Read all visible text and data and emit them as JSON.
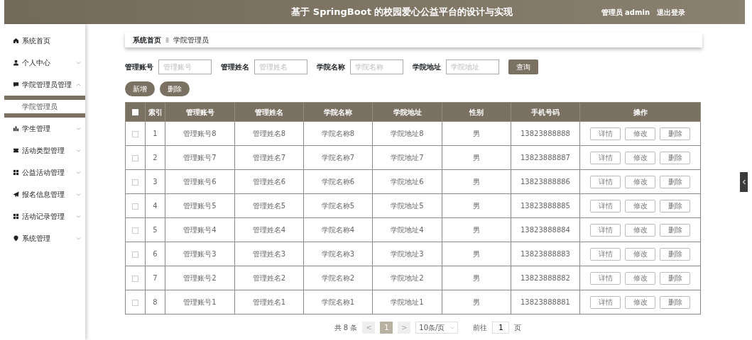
{
  "header": {
    "title": "基于 SpringBoot 的校园爱心公益平台的设计与实现",
    "user": "管理员 admin",
    "logout": "退出登录"
  },
  "sidebar": {
    "items": [
      {
        "label": "系统首页",
        "kind": "link"
      },
      {
        "label": "个人中心",
        "kind": "menu",
        "expanded": false
      },
      {
        "label": "学院管理员管理",
        "kind": "menu",
        "expanded": true,
        "children": [
          {
            "label": "学院管理员",
            "selected": true
          }
        ]
      },
      {
        "label": "学生管理",
        "kind": "menu",
        "expanded": false
      },
      {
        "label": "活动类型管理",
        "kind": "menu",
        "expanded": false
      },
      {
        "label": "公益活动管理",
        "kind": "menu",
        "expanded": false
      },
      {
        "label": "报名信息管理",
        "kind": "menu",
        "expanded": false
      },
      {
        "label": "活动记录管理",
        "kind": "menu",
        "expanded": false
      },
      {
        "label": "系统管理",
        "kind": "menu",
        "expanded": false
      }
    ]
  },
  "breadcrumb": [
    "系统首页",
    "学院管理员"
  ],
  "search": {
    "fields": [
      {
        "label": "管理账号",
        "placeholder": "管理账号"
      },
      {
        "label": "管理姓名",
        "placeholder": "管理姓名"
      },
      {
        "label": "学院名称",
        "placeholder": "学院名称"
      },
      {
        "label": "学院地址",
        "placeholder": "学院地址"
      }
    ],
    "button": "查询"
  },
  "actions": [
    "新增",
    "删除"
  ],
  "table": {
    "select_all_checked": false,
    "columns": [
      "索引",
      "管理账号",
      "管理姓名",
      "学院名称",
      "学院地址",
      "性别",
      "手机号码",
      "操作"
    ],
    "rows": [
      {
        "checked": false,
        "cells": [
          "1",
          "管理账号8",
          "管理姓名8",
          "学院名称8",
          "学院地址8",
          "男",
          "13823888888"
        ],
        "buttons": [
          "详情",
          "修改",
          "删除"
        ]
      },
      {
        "checked": false,
        "cells": [
          "2",
          "管理账号7",
          "管理姓名7",
          "学院名称7",
          "学院地址7",
          "男",
          "13823888887"
        ],
        "buttons": [
          "详情",
          "修改",
          "删除"
        ]
      },
      {
        "checked": false,
        "cells": [
          "3",
          "管理账号6",
          "管理姓名6",
          "学院名称6",
          "学院地址6",
          "男",
          "13823888886"
        ],
        "buttons": [
          "详情",
          "修改",
          "删除"
        ]
      },
      {
        "checked": false,
        "cells": [
          "4",
          "管理账号5",
          "管理姓名5",
          "学院名称5",
          "学院地址5",
          "男",
          "13823888885"
        ],
        "buttons": [
          "详情",
          "修改",
          "删除"
        ]
      },
      {
        "checked": false,
        "cells": [
          "5",
          "管理账号4",
          "管理姓名4",
          "学院名称4",
          "学院地址4",
          "男",
          "13823888884"
        ],
        "buttons": [
          "详情",
          "修改",
          "删除"
        ]
      },
      {
        "checked": false,
        "cells": [
          "6",
          "管理账号3",
          "管理姓名3",
          "学院名称3",
          "学院地址3",
          "男",
          "13823888883"
        ],
        "buttons": [
          "详情",
          "修改",
          "删除"
        ]
      },
      {
        "checked": false,
        "cells": [
          "7",
          "管理账号2",
          "管理姓名2",
          "学院名称2",
          "学院地址2",
          "男",
          "13823888882"
        ],
        "buttons": [
          "详情",
          "修改",
          "删除"
        ]
      },
      {
        "checked": false,
        "cells": [
          "8",
          "管理账号1",
          "管理姓名1",
          "学院名称1",
          "学院地址1",
          "男",
          "13823888881"
        ],
        "buttons": [
          "详情",
          "修改",
          "删除"
        ]
      }
    ]
  },
  "pagination": {
    "total": "共 8 条",
    "prev": "<",
    "pages": [
      {
        "label": "1",
        "selected": true
      }
    ],
    "next": ">",
    "page_size": "10条/页",
    "goto_label": "前往",
    "goto_value": "1",
    "page_unit": "页"
  }
}
